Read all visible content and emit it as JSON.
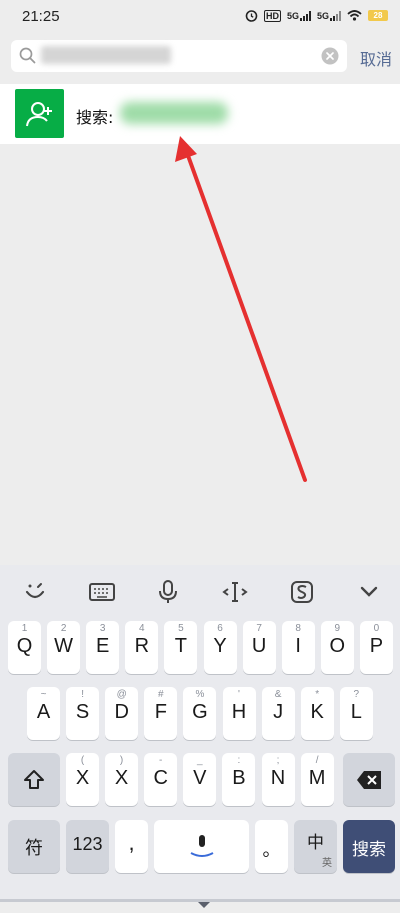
{
  "status": {
    "time": "21:25",
    "icons": [
      "alarm-icon",
      "hd-icon",
      "5g-signal-icon",
      "5g-signal-icon",
      "wifi-icon"
    ],
    "hd": "HD",
    "sig1": "5G",
    "sig2": "5G",
    "battery": "28"
  },
  "search": {
    "value": "",
    "cancel_label": "取消"
  },
  "result": {
    "label": "搜索:"
  },
  "colors": {
    "accent_green": "#07ad46",
    "cancel_blue": "#566b94",
    "search_key": "#3f4e76",
    "arrow": "#e53030"
  },
  "keyboard": {
    "toolbar": [
      "emoji-icon",
      "keyboard-icon",
      "microphone-icon",
      "cursor-icon",
      "sogou-logo-icon",
      "collapse-icon"
    ],
    "row1": [
      {
        "hint": "1",
        "label": "Q"
      },
      {
        "hint": "2",
        "label": "W"
      },
      {
        "hint": "3",
        "label": "E"
      },
      {
        "hint": "4",
        "label": "R"
      },
      {
        "hint": "5",
        "label": "T"
      },
      {
        "hint": "6",
        "label": "Y"
      },
      {
        "hint": "7",
        "label": "U"
      },
      {
        "hint": "8",
        "label": "I"
      },
      {
        "hint": "9",
        "label": "O"
      },
      {
        "hint": "0",
        "label": "P"
      }
    ],
    "row2": [
      {
        "hint": "~",
        "label": "A"
      },
      {
        "hint": "!",
        "label": "S"
      },
      {
        "hint": "@",
        "label": "D"
      },
      {
        "hint": "#",
        "label": "F"
      },
      {
        "hint": "%",
        "label": "G"
      },
      {
        "hint": "'",
        "label": "H"
      },
      {
        "hint": "&",
        "label": "J"
      },
      {
        "hint": "*",
        "label": "K"
      },
      {
        "hint": "?",
        "label": "L"
      }
    ],
    "row3": [
      {
        "hint": "(",
        "label": "X"
      },
      {
        "hint": ")",
        "label": "X"
      },
      {
        "hint": "-",
        "label": "C"
      },
      {
        "hint": "_",
        "label": "V"
      },
      {
        "hint": ":",
        "label": "B"
      },
      {
        "hint": ";",
        "label": "N"
      },
      {
        "hint": "/",
        "label": "M"
      }
    ],
    "row4": {
      "symbols": "符",
      "numbers": "123",
      "comma": ",",
      "period": "。",
      "lang": "中",
      "lang_sub": "英",
      "search": "搜索"
    }
  }
}
